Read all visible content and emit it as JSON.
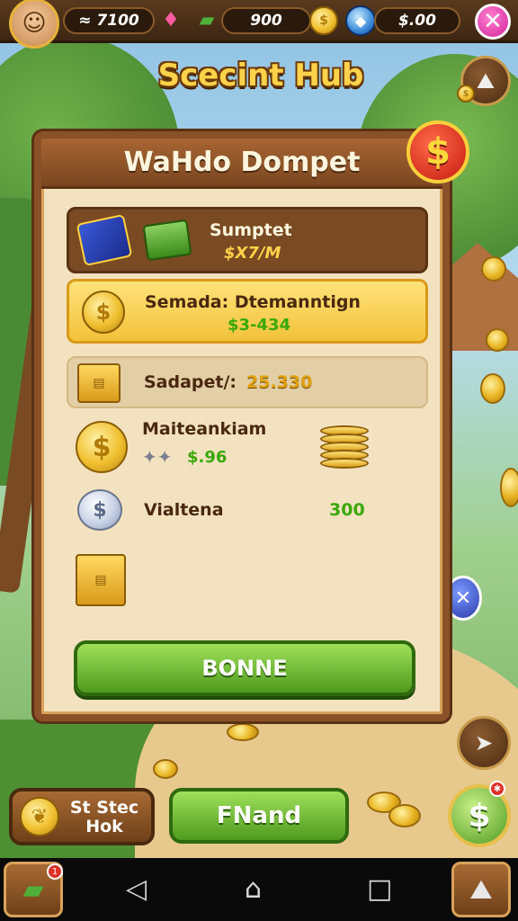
{
  "topbar": {
    "coins_value": "≈ 7100",
    "cash_value": "900",
    "diamond_value": "$.00",
    "close_glyph": "✕"
  },
  "hub": {
    "title": "Scecint Hub"
  },
  "panel": {
    "title": "WaHdo Dompet",
    "badge_glyph": "$",
    "rows": [
      {
        "title": "Sumptet",
        "value": "$X7/M"
      },
      {
        "title": "Semada: Dtemanntign",
        "value": "$3-434"
      },
      {
        "title": "Sadapet/:",
        "value": "25.330"
      },
      {
        "title": "Maiteankiam",
        "value": "$.96"
      },
      {
        "title": "Vialtena",
        "value": "300"
      }
    ],
    "bonus_label": "BONNE"
  },
  "bottom": {
    "hub_label_1": "St Stec",
    "hub_label_2": "Hok",
    "friend_label": "FNand",
    "cash_glyph": "$"
  },
  "colors": {
    "accent_gold": "#f2c23a",
    "accent_green": "#4f9a1e",
    "panel_bg": "#f3e2bf",
    "wood": "#8a5128",
    "value_green": "#3aa80a"
  }
}
